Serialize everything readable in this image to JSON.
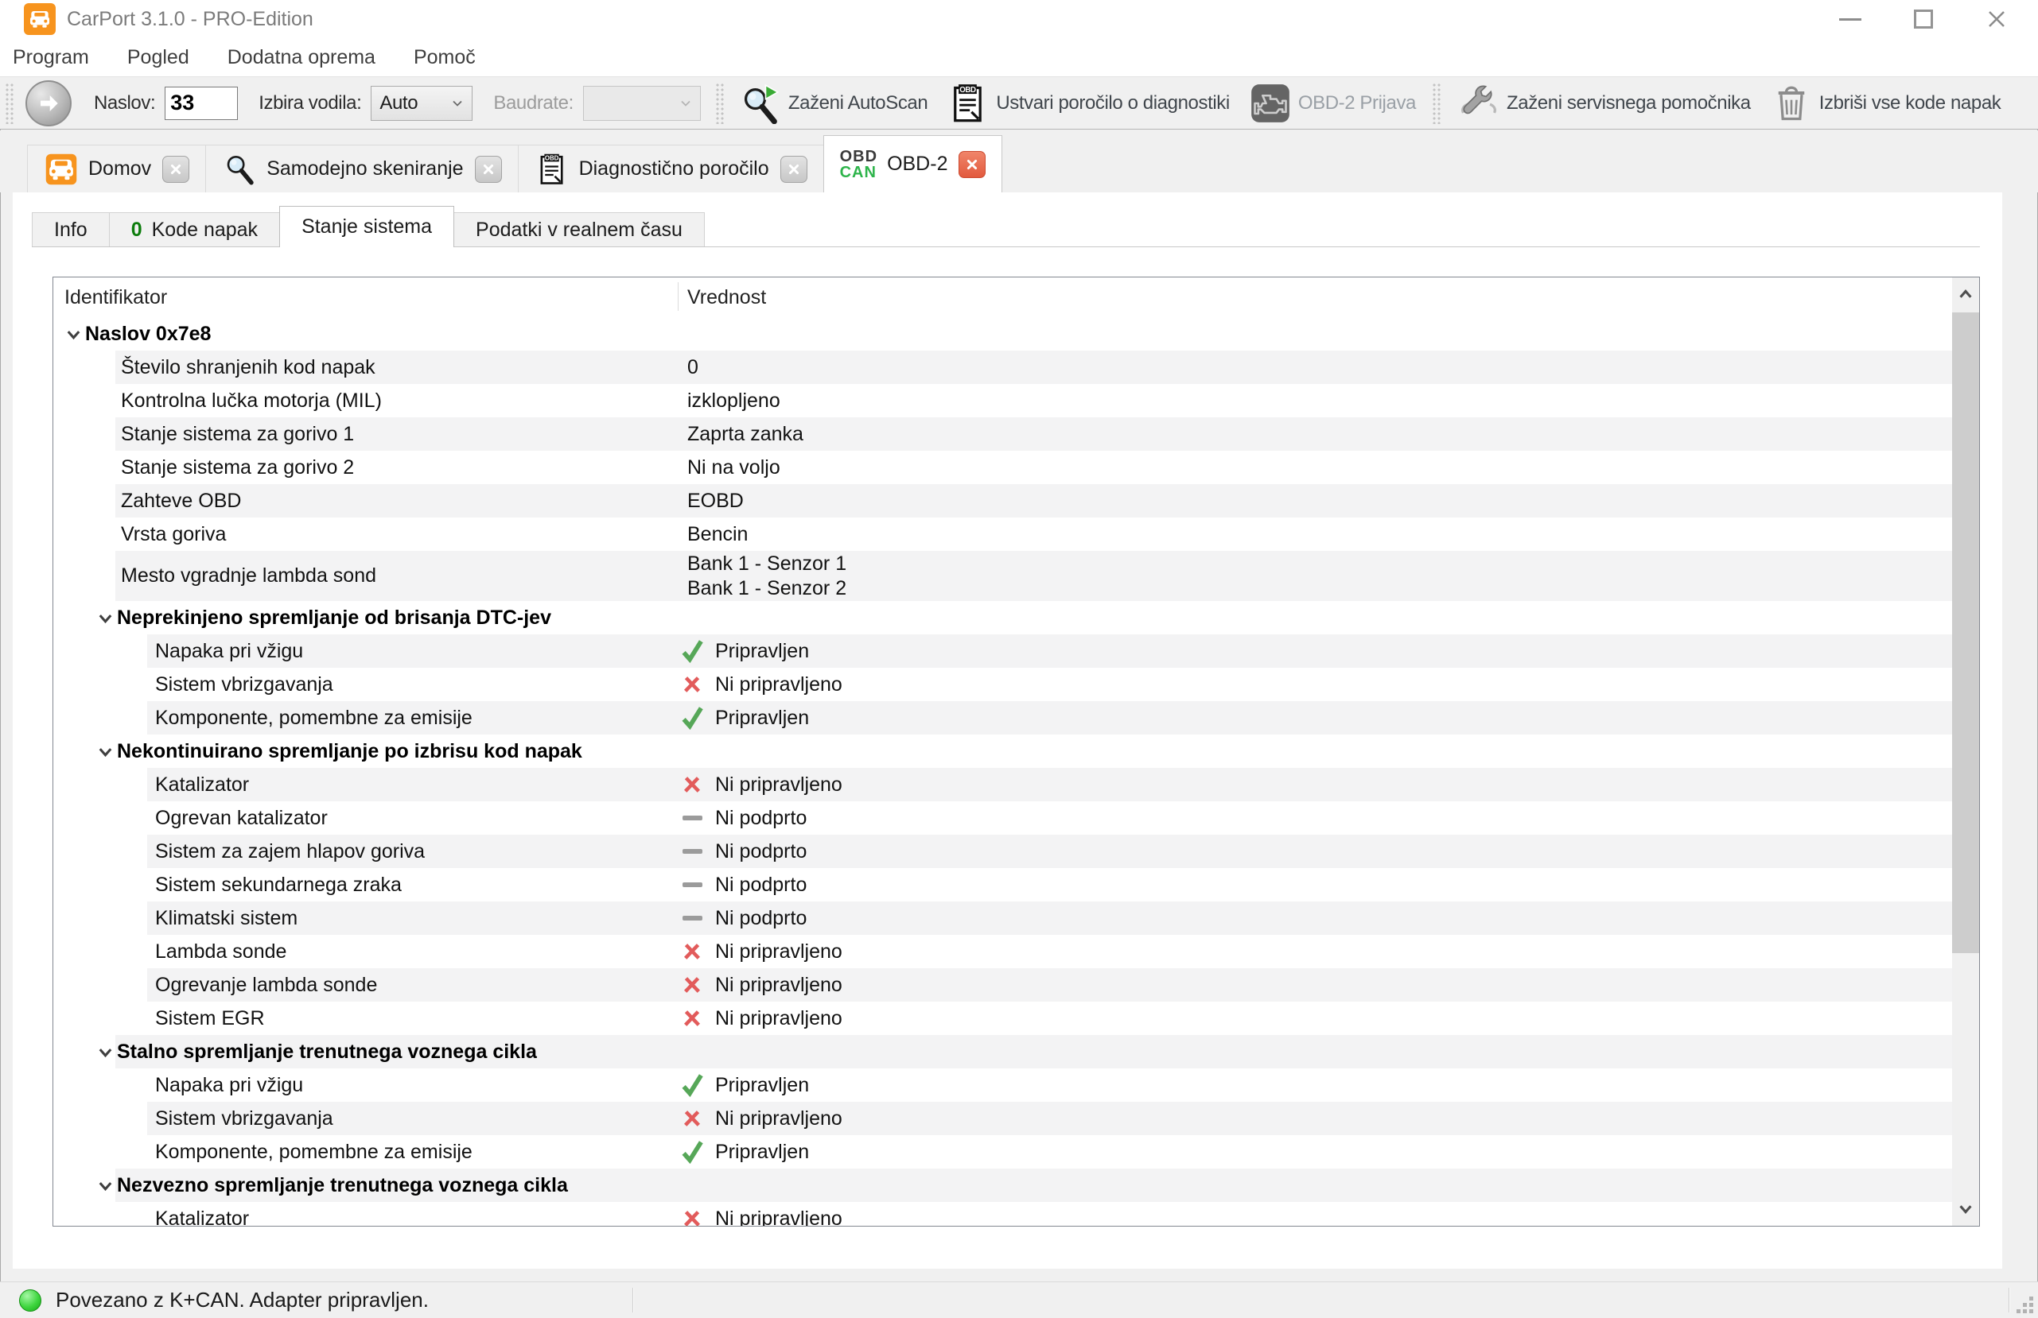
{
  "titlebar": {
    "title": "CarPort 3.1.0 - PRO-Edition"
  },
  "menubar": {
    "items": [
      "Program",
      "Pogled",
      "Dodatna oprema",
      "Pomoč"
    ]
  },
  "toolbar": {
    "address_label": "Naslov:",
    "address_value": "33",
    "bus_label": "Izbira vodila:",
    "bus_value": "Auto",
    "baudrate_label": "Baudrate:",
    "baudrate_value": "",
    "buttons": [
      {
        "id": "autoscan",
        "icon": "autoscan-icon",
        "label": "Zaženi AutoScan",
        "enabled": true
      },
      {
        "id": "diagnostic-report",
        "icon": "obd-report-icon",
        "label": "Ustvari poročilo o diagnostiki",
        "enabled": true
      },
      {
        "id": "obd2-login",
        "icon": "engine-icon",
        "label": "OBD-2 Prijava",
        "enabled": false
      },
      {
        "id": "service-assistant",
        "icon": "wrench-icon",
        "label": "Zaženi servisnega pomočnika",
        "enabled": true
      },
      {
        "id": "clear-fault-codes",
        "icon": "trash-icon",
        "label": "Izbriši vse kode napak",
        "enabled": true
      }
    ]
  },
  "tabs": [
    {
      "id": "domov",
      "icon": "car-icon",
      "label": "Domov",
      "active": false,
      "close": "gray"
    },
    {
      "id": "autoscan",
      "icon": "magnifier-icon",
      "label": "Samodejno skeniranje",
      "active": false,
      "close": "gray"
    },
    {
      "id": "report",
      "icon": "obd-report-icon",
      "label": "Diagnostično poročilo",
      "active": false,
      "close": "gray"
    },
    {
      "id": "obd2",
      "icon": "obd-can-icon",
      "icon_text_top": "OBD",
      "icon_text_bottom": "CAN",
      "label": "OBD-2",
      "active": true,
      "close": "red"
    }
  ],
  "subtabs": [
    {
      "id": "info",
      "label": "Info",
      "active": false
    },
    {
      "id": "kode-napak",
      "label": "Kode napak",
      "badge": "0",
      "active": false
    },
    {
      "id": "stanje-sistema",
      "label": "Stanje sistema",
      "active": true
    },
    {
      "id": "realtime",
      "label": "Podatki v realnem času",
      "active": false
    }
  ],
  "system_status": {
    "columns": [
      "Identifikator",
      "Vrednost"
    ],
    "status_icons": {
      "ready": "check-icon",
      "not_ready": "cross-icon",
      "not_supported": "dash-icon"
    },
    "rows": [
      {
        "type": "group",
        "level": 0,
        "label": "Naslov 0x7e8"
      },
      {
        "type": "item",
        "level": 1,
        "label": "Število shranjenih kod napak",
        "value": "0"
      },
      {
        "type": "item",
        "level": 1,
        "label": "Kontrolna lučka motorja (MIL)",
        "value": "izklopljeno"
      },
      {
        "type": "item",
        "level": 1,
        "label": "Stanje sistema za gorivo 1",
        "value": "Zaprta zanka"
      },
      {
        "type": "item",
        "level": 1,
        "label": "Stanje sistema za gorivo 2",
        "value": "Ni na voljo"
      },
      {
        "type": "item",
        "level": 1,
        "label": "Zahteve OBD",
        "value": "EOBD"
      },
      {
        "type": "item",
        "level": 1,
        "label": "Vrsta goriva",
        "value": "Bencin"
      },
      {
        "type": "item",
        "level": 1,
        "label": "Mesto vgradnje lambda sond",
        "value_lines": [
          "Bank 1 - Senzor 1",
          "Bank 1 - Senzor 2"
        ]
      },
      {
        "type": "group",
        "level": 1,
        "label": "Neprekinjeno spremljanje od brisanja DTC-jev"
      },
      {
        "type": "item",
        "level": 2,
        "label": "Napaka pri vžigu",
        "status": "ready",
        "value": "Pripravljen"
      },
      {
        "type": "item",
        "level": 2,
        "label": "Sistem vbrizgavanja",
        "status": "not_ready",
        "value": "Ni pripravljeno"
      },
      {
        "type": "item",
        "level": 2,
        "label": "Komponente, pomembne za emisije",
        "status": "ready",
        "value": "Pripravljen"
      },
      {
        "type": "group",
        "level": 1,
        "label": "Nekontinuirano spremljanje po izbrisu kod napak"
      },
      {
        "type": "item",
        "level": 2,
        "label": "Katalizator",
        "status": "not_ready",
        "value": "Ni pripravljeno"
      },
      {
        "type": "item",
        "level": 2,
        "label": "Ogrevan katalizator",
        "status": "not_supported",
        "value": "Ni podprto"
      },
      {
        "type": "item",
        "level": 2,
        "label": "Sistem za zajem hlapov goriva",
        "status": "not_supported",
        "value": "Ni podprto"
      },
      {
        "type": "item",
        "level": 2,
        "label": "Sistem sekundarnega zraka",
        "status": "not_supported",
        "value": "Ni podprto"
      },
      {
        "type": "item",
        "level": 2,
        "label": "Klimatski sistem",
        "status": "not_supported",
        "value": "Ni podprto"
      },
      {
        "type": "item",
        "level": 2,
        "label": "Lambda sonde",
        "status": "not_ready",
        "value": "Ni pripravljeno"
      },
      {
        "type": "item",
        "level": 2,
        "label": "Ogrevanje lambda sonde",
        "status": "not_ready",
        "value": "Ni pripravljeno"
      },
      {
        "type": "item",
        "level": 2,
        "label": "Sistem EGR",
        "status": "not_ready",
        "value": "Ni pripravljeno"
      },
      {
        "type": "group",
        "level": 1,
        "label": "Stalno spremljanje trenutnega voznega cikla"
      },
      {
        "type": "item",
        "level": 2,
        "label": "Napaka pri vžigu",
        "status": "ready",
        "value": "Pripravljen"
      },
      {
        "type": "item",
        "level": 2,
        "label": "Sistem vbrizgavanja",
        "status": "not_ready",
        "value": "Ni pripravljeno"
      },
      {
        "type": "item",
        "level": 2,
        "label": "Komponente, pomembne za emisije",
        "status": "ready",
        "value": "Pripravljen"
      },
      {
        "type": "group",
        "level": 1,
        "label": "Nezvezno spremljanje trenutnega voznega cikla"
      },
      {
        "type": "item",
        "level": 2,
        "label": "Katalizator",
        "status": "not_ready",
        "value": "Ni pripravljeno"
      }
    ]
  },
  "statusbar": {
    "message": "Povezano z K+CAN. Adapter pripravljen."
  },
  "colors": {
    "accent_orange": "#f7941e",
    "ready_green": "#56a758",
    "not_ready_red": "#e25b5b",
    "not_supported_gray": "#9b9b9b",
    "can_green": "#2eb44b",
    "dtc_count_green": "#0d7d0d",
    "led_green": "#3fd63f",
    "active_close_red": "#e25a3e"
  }
}
